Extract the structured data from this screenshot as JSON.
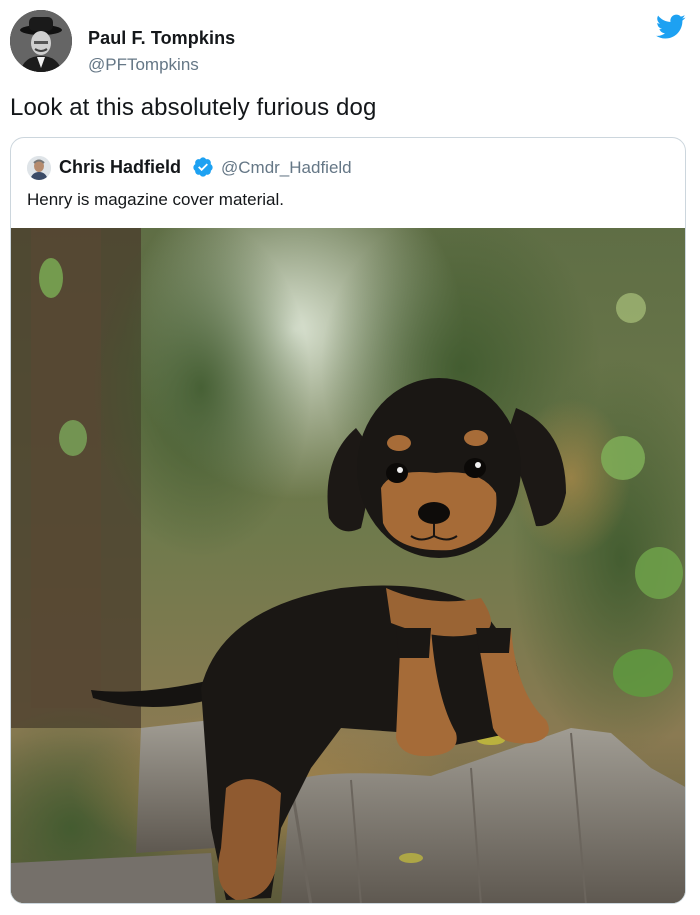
{
  "author": {
    "name": "Paul F. Tompkins",
    "handle": "@PFTompkins"
  },
  "tweet": {
    "text": "Look at this absolutely furious dog"
  },
  "quoted": {
    "name": "Chris Hadfield",
    "handle": "@Cmdr_Hadfield",
    "text": "Henry is magazine cover material.",
    "verified": true
  },
  "colors": {
    "brand_blue": "#1da1f2",
    "text": "#14171a",
    "secondary": "#657786",
    "border": "#ccd6dd"
  },
  "icons": {
    "brand": "twitter-bird-icon",
    "verified": "verified-badge-icon"
  }
}
